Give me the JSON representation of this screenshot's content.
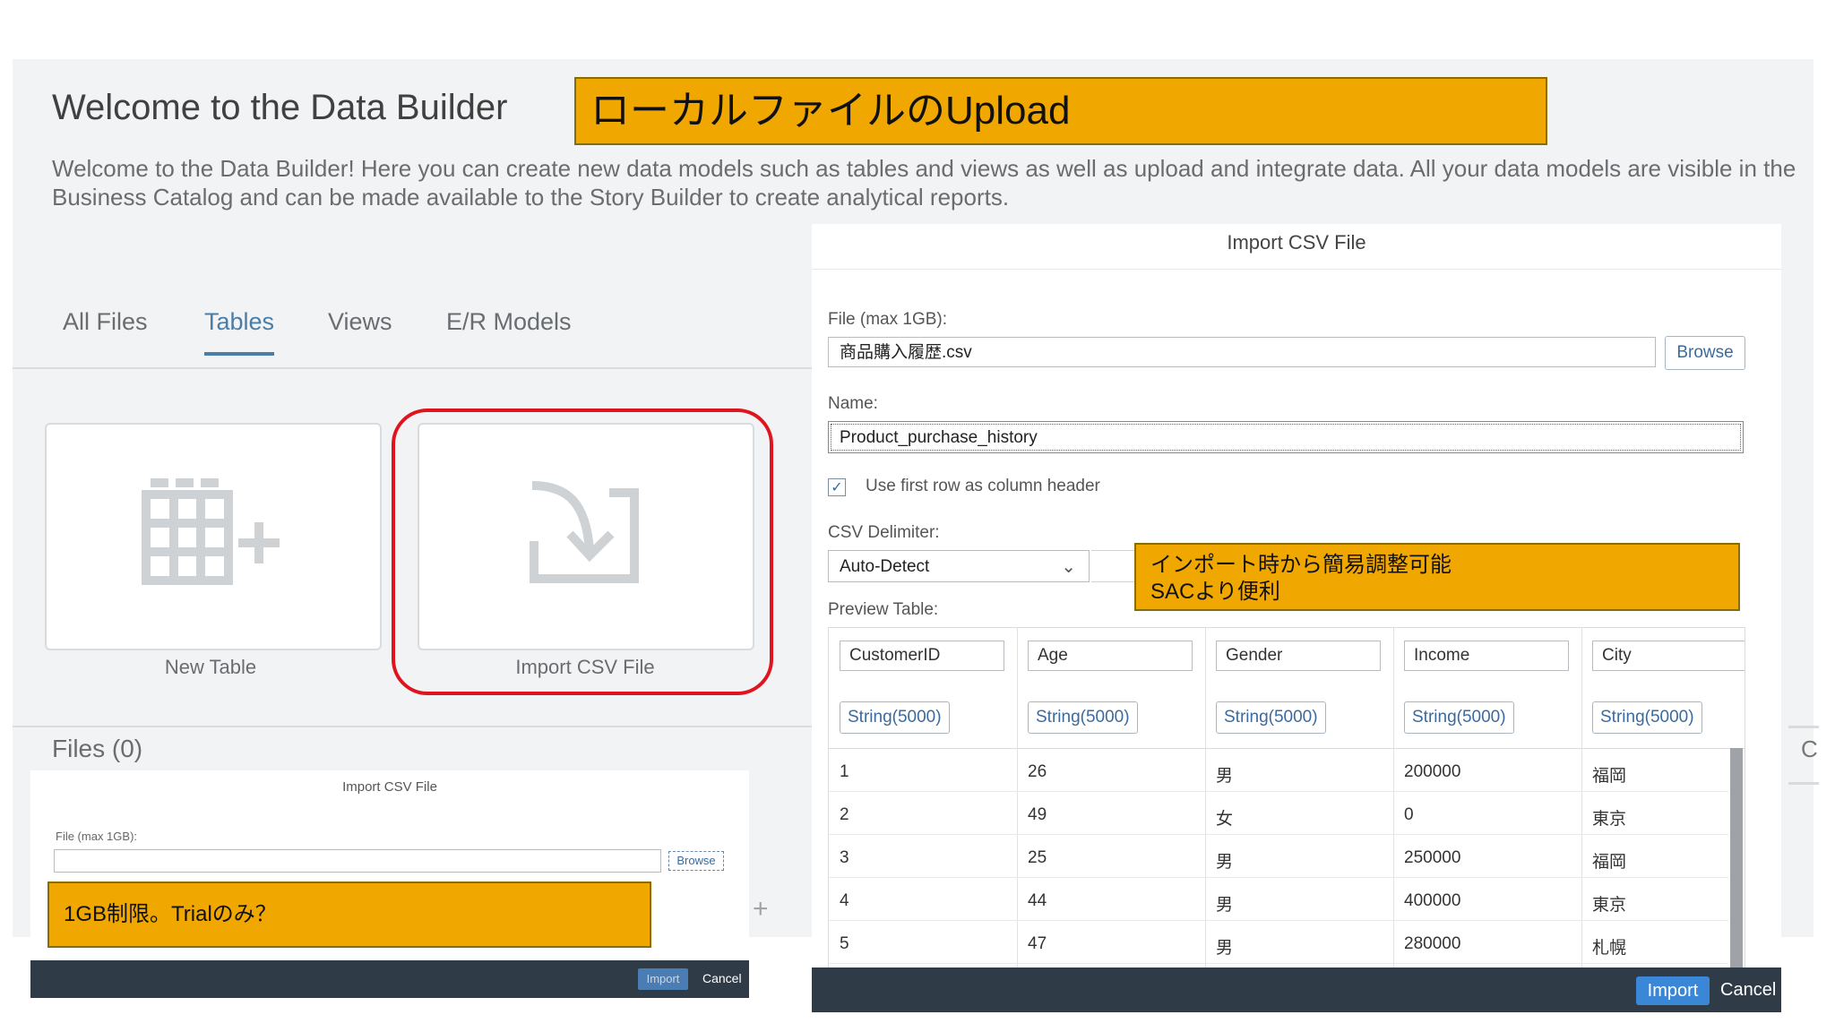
{
  "page": {
    "title": "Welcome to the Data Builder",
    "description": "Welcome to the Data Builder! Here you can create new data models such as tables and views as well as upload and integrate data. All your data models are visible in the Business Catalog and can be made available to the Story Builder to create analytical reports."
  },
  "tabs": [
    {
      "label": "All Files"
    },
    {
      "label": "Tables"
    },
    {
      "label": "Views"
    },
    {
      "label": "E/R Models"
    }
  ],
  "tiles": {
    "new_table": "New Table",
    "import_csv": "Import CSV File"
  },
  "files_header": "Files (0)",
  "small_dialog": {
    "title": "Import CSV File",
    "file_label": "File (max 1GB):",
    "browse": "Browse",
    "import": "Import",
    "cancel": "Cancel"
  },
  "dialog": {
    "title": "Import CSV File",
    "file_label": "File (max 1GB):",
    "file_value": "商品購入履歴.csv",
    "browse": "Browse",
    "name_label": "Name:",
    "name_value": "Product_purchase_history",
    "checkbox_label": "Use first row as column header",
    "checkbox_mark": "✓",
    "delimiter_label": "CSV Delimiter:",
    "delimiter_value": "Auto-Detect",
    "preview_label": "Preview Table:",
    "columns": [
      {
        "name": "CustomerID",
        "type": "String(5000)"
      },
      {
        "name": "Age",
        "type": "String(5000)"
      },
      {
        "name": "Gender",
        "type": "String(5000)"
      },
      {
        "name": "Income",
        "type": "String(5000)"
      },
      {
        "name": "City",
        "type": "String(5000)"
      }
    ],
    "rows": [
      [
        "1",
        "26",
        "男",
        "200000",
        "福岡"
      ],
      [
        "2",
        "49",
        "女",
        "0",
        "東京"
      ],
      [
        "3",
        "25",
        "男",
        "250000",
        "福岡"
      ],
      [
        "4",
        "44",
        "男",
        "400000",
        "東京"
      ],
      [
        "5",
        "47",
        "男",
        "280000",
        "札幌"
      ]
    ],
    "import": "Import",
    "cancel": "Cancel"
  },
  "right_edge_glyph": "C",
  "annotations": {
    "main": "ローカルファイルのUpload",
    "mid_line1": "インポート時から簡易調整可能",
    "mid_line2": "SACより便利",
    "small": "1GB制限。Trialのみ？"
  },
  "colors": {
    "accent": "#4a7da8",
    "callout": "#f0a800",
    "highlight_ring": "#e0141e",
    "footer": "#2f3b47",
    "import_button": "#3a87d8"
  },
  "icons": {
    "new_table": "table-plus-icon",
    "import_csv": "import-arrow-icon",
    "delimiter": "chevron-down-icon"
  }
}
